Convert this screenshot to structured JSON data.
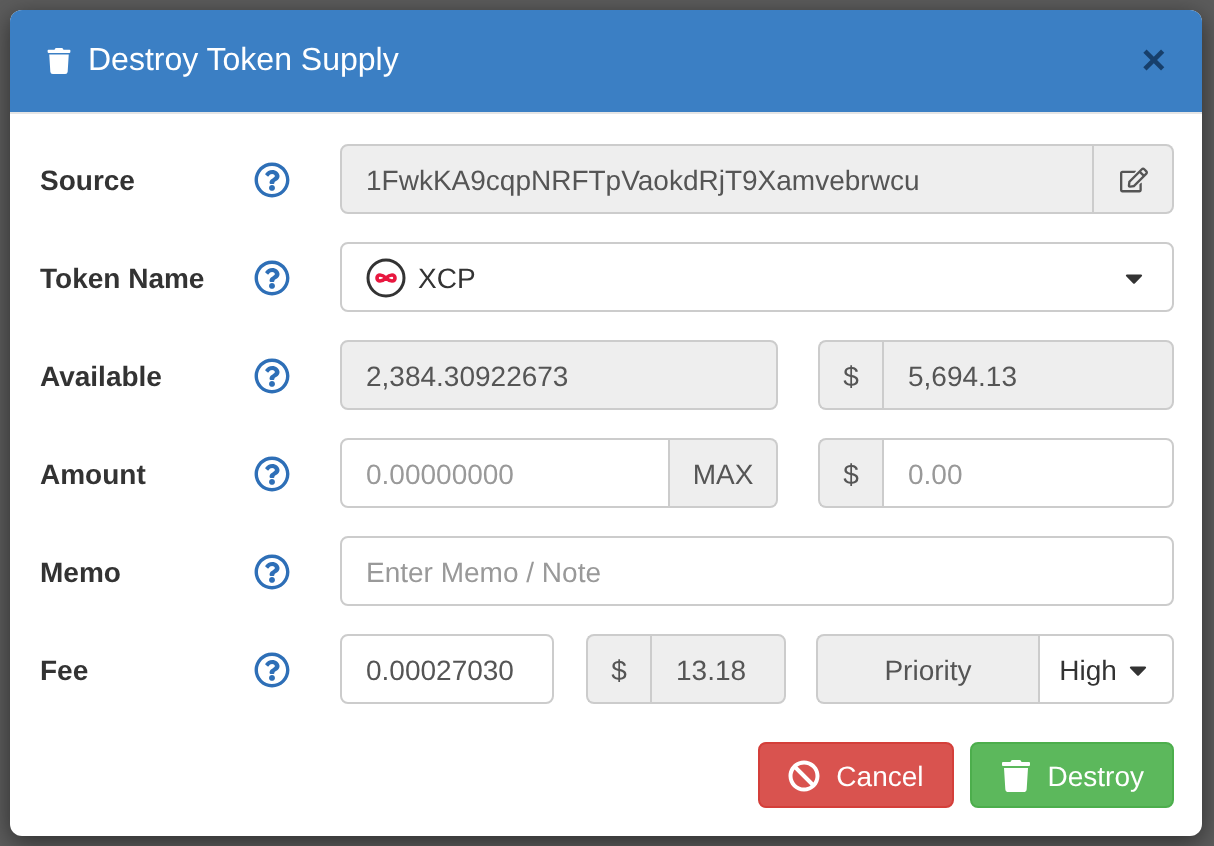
{
  "dialog": {
    "title": "Destroy Token Supply",
    "close": "×"
  },
  "rows": [
    {
      "kind": "address",
      "label": "Source",
      "value": "1FwkKA9cqpNRFTpVaokdRjT9Xamvebrwcu",
      "readonly": true
    },
    {
      "kind": "select",
      "label": "Token Name",
      "value": "XCP"
    },
    {
      "kind": "amount_pair",
      "label": "Available",
      "value": "2,384.30922673",
      "currency": "$",
      "usd_value": "5,694.13",
      "readonly": true
    },
    {
      "kind": "amount_max",
      "label": "Amount",
      "placeholder": "0.00000000",
      "max_label": "MAX",
      "currency": "$",
      "usd_placeholder": "0.00"
    },
    {
      "kind": "text",
      "label": "Memo",
      "placeholder": "Enter Memo / Note"
    },
    {
      "kind": "fee",
      "label": "Fee",
      "value": "0.00027030",
      "currency": "$",
      "usd_value": "13.18",
      "priority_label": "Priority",
      "priority": "High"
    }
  ],
  "buttons": [
    {
      "kind": "cancel",
      "label": "Cancel"
    },
    {
      "kind": "destroy",
      "label": "Destroy"
    }
  ]
}
